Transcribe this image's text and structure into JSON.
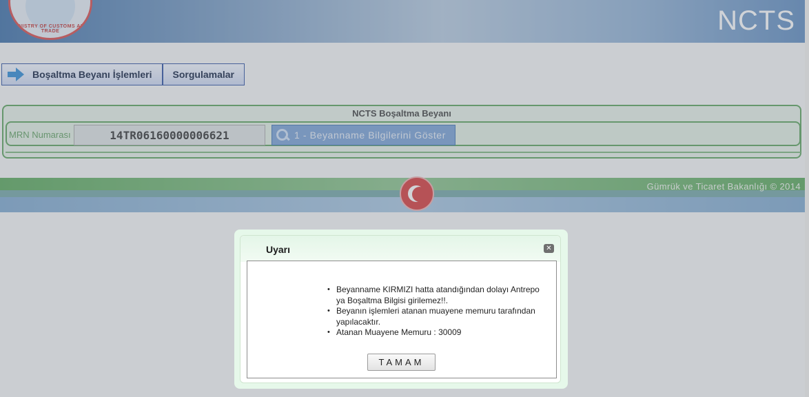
{
  "header": {
    "logo_text": "MINISTRY OF CUSTOMS AND TRADE",
    "brand": "NCTS"
  },
  "menu": {
    "items": [
      {
        "label": "Boşaltma Beyanı İşlemleri",
        "icon": "arrow-right-icon"
      },
      {
        "label": "Sorgulamalar"
      }
    ]
  },
  "panel": {
    "title": "NCTS Boşaltma Beyanı",
    "mrn_label": "MRN Numarası",
    "mrn_value": "14TR06160000006621",
    "show_button_label": "1 - Beyanname Bilgilerini Göster",
    "show_button_icon": "magnifier-icon"
  },
  "footer": {
    "copyright": "Gümrük ve Ticaret Bakanlığı © 2014"
  },
  "dialog": {
    "title": "Uyarı",
    "messages": [
      "Beyanname KIRMIZI hatta atandığından dolayı Antrepo ya Boşaltma Bilgisi girilemez!!.",
      "Beyanın işlemleri atanan muayene memuru tarafından yapılacaktır.",
      "Atanan Muayene Memuru : 30009"
    ],
    "ok_label": "TAMAM"
  },
  "colors": {
    "accent_green": "#5ca45c",
    "menu_border": "#2b4fa0",
    "button_blue": "#7aa2d6",
    "emblem_red": "#d83a3a"
  }
}
